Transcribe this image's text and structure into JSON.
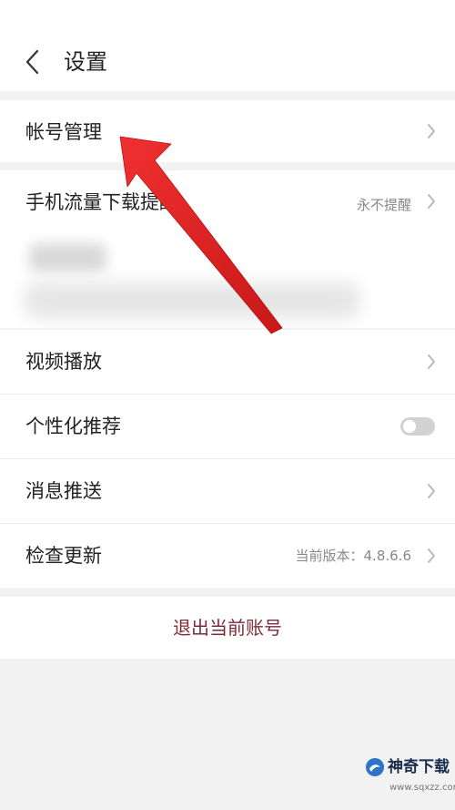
{
  "header": {
    "title": "设置",
    "back_icon": "chevron-left-icon"
  },
  "rows": {
    "account": {
      "label": "帐号管理"
    },
    "data_download": {
      "label": "手机流量下载提醒",
      "value": "永不提醒"
    },
    "video": {
      "label": "视频播放"
    },
    "recommend": {
      "label": "个性化推荐",
      "toggle_on": false
    },
    "push": {
      "label": "消息推送"
    },
    "update": {
      "label": "检查更新",
      "value": "当前版本：4.8.6.6"
    }
  },
  "logout": {
    "label": "退出当前账号",
    "color": "#7c2b3a"
  },
  "annotation": {
    "arrow_color": "#e02424",
    "target": "帐号管理"
  },
  "watermark": {
    "title": "神奇下载",
    "url": "www.sqxzz.com"
  },
  "colors": {
    "background": "#f2f2f2",
    "row": "#ffffff",
    "secondary_text": "#888888"
  }
}
